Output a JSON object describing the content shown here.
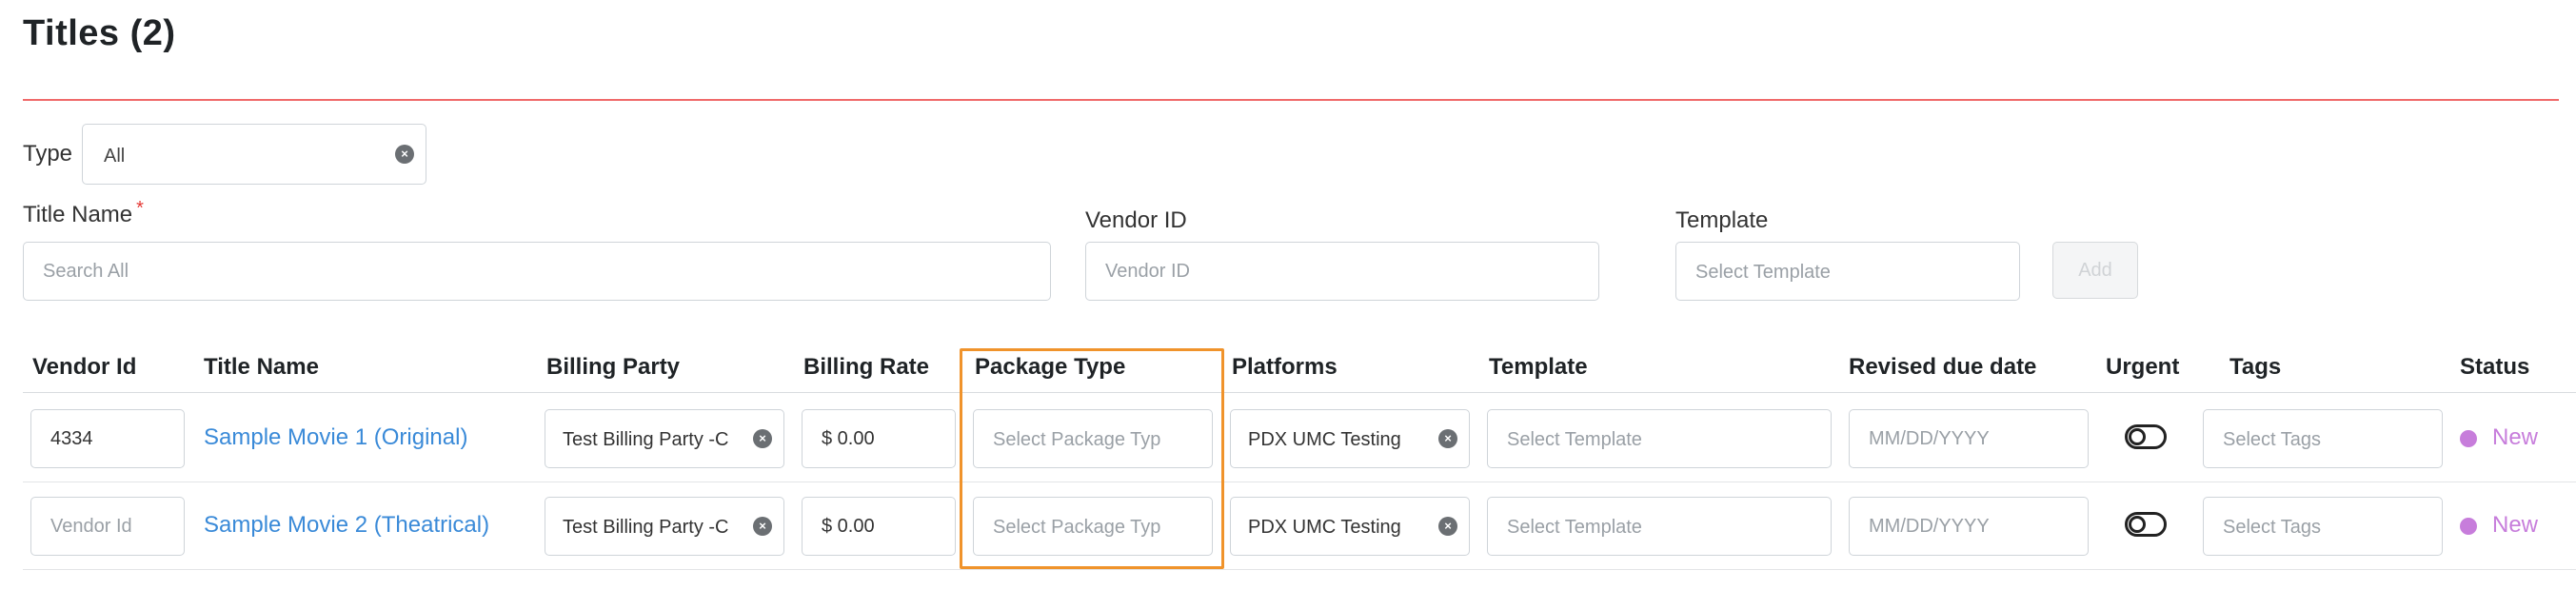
{
  "page": {
    "title": "Titles (2)"
  },
  "filters": {
    "type_label": "Type",
    "type_value": "All",
    "title_name_label": "Title Name",
    "title_name_required_mark": "*",
    "title_name_placeholder": "Search All",
    "vendor_id_label": "Vendor ID",
    "vendor_id_placeholder": "Vendor ID",
    "template_label": "Template",
    "template_placeholder": "Select Template",
    "add_label": "Add"
  },
  "table": {
    "columns": [
      "Vendor Id",
      "Title Name",
      "Billing Party",
      "Billing Rate",
      "Package Type",
      "Platforms",
      "Template",
      "Revised due date",
      "Urgent",
      "Tags",
      "Status"
    ],
    "rows": [
      {
        "vendor_id_value": "4334",
        "vendor_id_placeholder": "Vendor Id",
        "title_name": "Sample Movie 1 (Original)",
        "billing_party": "Test Billing Party  -C",
        "billing_rate": "$ 0.00",
        "package_type_placeholder": "Select Package Typ",
        "platforms": "PDX UMC Testing",
        "template_placeholder": "Select Template",
        "due_date_placeholder": "MM/DD/YYYY",
        "urgent": false,
        "tags_placeholder": "Select Tags",
        "status": "New"
      },
      {
        "vendor_id_value": "",
        "vendor_id_placeholder": "Vendor Id",
        "title_name": "Sample Movie 2 (Theatrical)",
        "billing_party": "Test Billing Party  -C",
        "billing_rate": "$ 0.00",
        "package_type_placeholder": "Select Package Typ",
        "platforms": "PDX UMC Testing",
        "template_placeholder": "Select Template",
        "due_date_placeholder": "MM/DD/YYYY",
        "urgent": false,
        "tags_placeholder": "Select Tags",
        "status": "New"
      }
    ]
  },
  "icons": {
    "clear": "clear-circle-x-icon",
    "clear_glyph": "×"
  },
  "colors": {
    "accent_rule": "#f06a6a",
    "link": "#3a8ad8",
    "status_new": "#c77ddb",
    "highlight": "#f0932b"
  }
}
